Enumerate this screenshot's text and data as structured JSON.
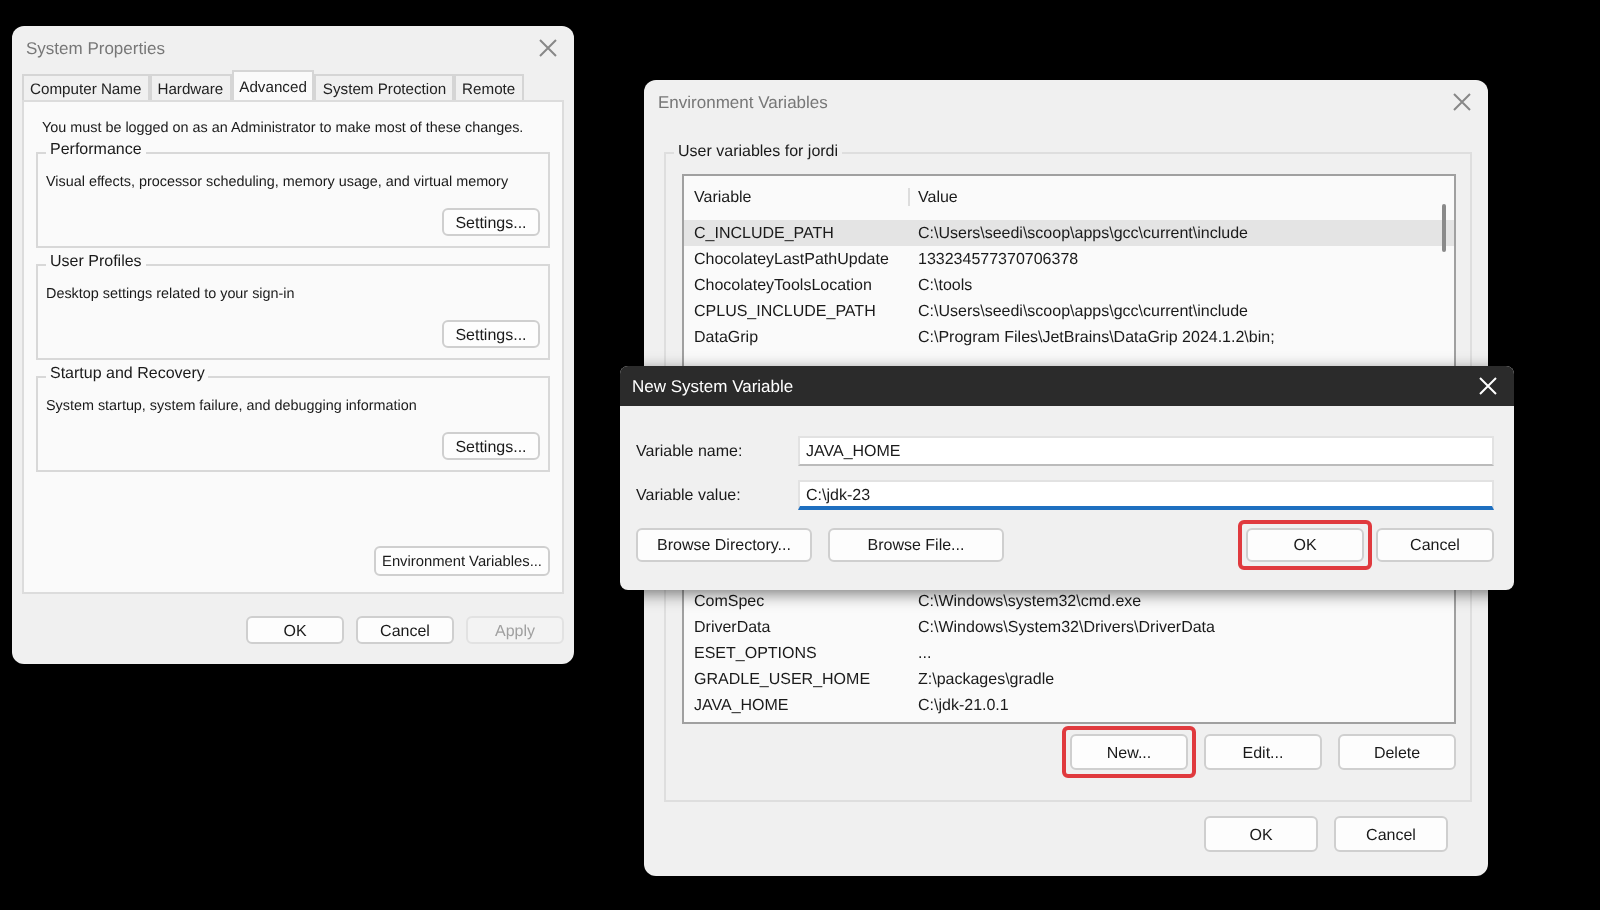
{
  "system_properties": {
    "title": "System Properties",
    "tabs": [
      {
        "label": "Computer Name",
        "selected": false
      },
      {
        "label": "Hardware",
        "selected": false
      },
      {
        "label": "Advanced",
        "selected": true
      },
      {
        "label": "System Protection",
        "selected": false
      },
      {
        "label": "Remote",
        "selected": false
      }
    ],
    "notice": "You must be logged on as an Administrator to make most of these changes.",
    "groups": [
      {
        "title": "Performance",
        "description": "Visual effects, processor scheduling, memory usage, and virtual memory",
        "button": "Settings..."
      },
      {
        "title": "User Profiles",
        "description": "Desktop settings related to your sign-in",
        "button": "Settings..."
      },
      {
        "title": "Startup and Recovery",
        "description": "System startup, system failure, and debugging information",
        "button": "Settings..."
      }
    ],
    "env_button": "Environment Variables...",
    "buttons": [
      {
        "label": "OK",
        "disabled": false
      },
      {
        "label": "Cancel",
        "disabled": false
      },
      {
        "label": "Apply",
        "disabled": true
      }
    ]
  },
  "environment_variables": {
    "title": "Environment Variables",
    "group_title": "User variables for jordi",
    "columns": [
      "Variable",
      "Value"
    ],
    "rows_above": [
      {
        "name": "C_INCLUDE_PATH",
        "value": "C:\\Users\\seedi\\scoop\\apps\\gcc\\current\\include",
        "selected": true
      },
      {
        "name": "ChocolateyLastPathUpdate",
        "value": "133234577370706378",
        "selected": false
      },
      {
        "name": "ChocolateyToolsLocation",
        "value": "C:\\tools",
        "selected": false
      },
      {
        "name": "CPLUS_INCLUDE_PATH",
        "value": "C:\\Users\\seedi\\scoop\\apps\\gcc\\current\\include",
        "selected": false
      },
      {
        "name": "DataGrip",
        "value": "C:\\Program Files\\JetBrains\\DataGrip 2024.1.2\\bin;",
        "selected": false
      }
    ],
    "rows_below": [
      {
        "name": "ComSpec",
        "value": "C:\\Windows\\system32\\cmd.exe",
        "selected": false
      },
      {
        "name": "DriverData",
        "value": "C:\\Windows\\System32\\Drivers\\DriverData",
        "selected": false
      },
      {
        "name": "ESET_OPTIONS",
        "value": "...",
        "selected": false
      },
      {
        "name": "GRADLE_USER_HOME",
        "value": "Z:\\packages\\gradle",
        "selected": false
      },
      {
        "name": "JAVA_HOME",
        "value": "C:\\jdk-21.0.1",
        "selected": false
      }
    ],
    "list_buttons": [
      {
        "label": "New...",
        "highlighted": true
      },
      {
        "label": "Edit...",
        "highlighted": false
      },
      {
        "label": "Delete",
        "highlighted": false
      }
    ],
    "buttons": [
      {
        "label": "OK"
      },
      {
        "label": "Cancel"
      }
    ]
  },
  "new_variable_dialog": {
    "title": "New System Variable",
    "fields": [
      {
        "label": "Variable name:",
        "value": "JAVA_HOME",
        "focused": false
      },
      {
        "label": "Variable value:",
        "value": "C:\\jdk-23",
        "focused": true
      }
    ],
    "browse_buttons": [
      {
        "label": "Browse Directory..."
      },
      {
        "label": "Browse File..."
      }
    ],
    "buttons": [
      {
        "label": "OK",
        "highlighted": true
      },
      {
        "label": "Cancel",
        "highlighted": false
      }
    ]
  }
}
